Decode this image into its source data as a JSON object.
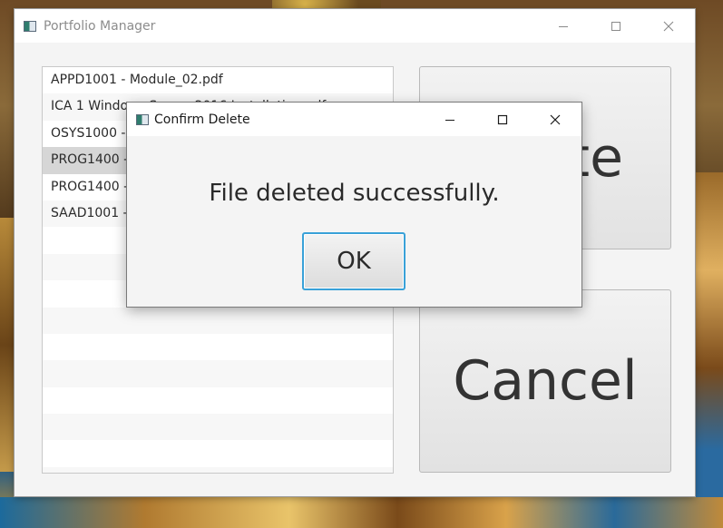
{
  "main_window": {
    "title": "Portfolio Manager",
    "files": [
      "APPD1001 - Module_02.pdf",
      "ICA 1 Windows Server 2016 Installation.pdf",
      "OSYS1000 - Midterm Review.pdf",
      "PROG1400 - Assignment 1.pdf",
      "PROG1400 - Assignment 2.pdf",
      "SAAD1001 - Project Proposal.pdf"
    ],
    "selected_index": 3,
    "delete_button_label": "Delete",
    "cancel_button_label": "Cancel"
  },
  "dialog": {
    "title": "Confirm Delete",
    "message": "File deleted successfully.",
    "ok_label": "OK"
  },
  "icons": {
    "app": "app-window-icon",
    "minimize": "minimize-icon",
    "maximize": "maximize-icon",
    "close": "close-icon"
  }
}
